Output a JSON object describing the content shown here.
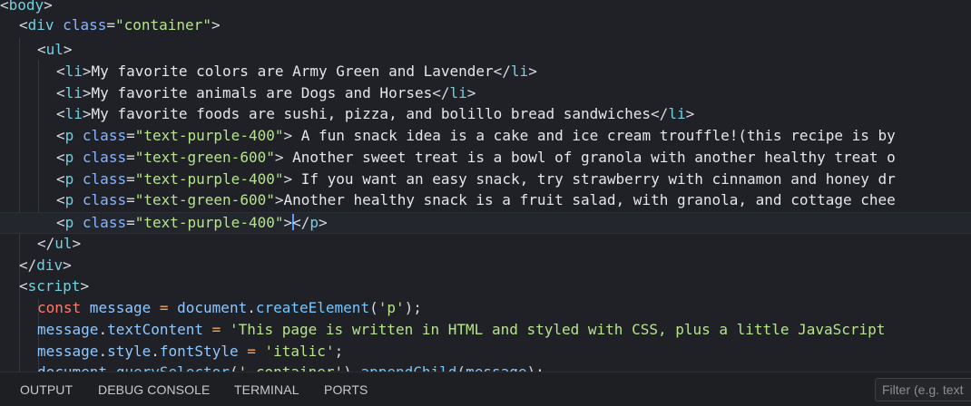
{
  "editor": {
    "lines": {
      "l0": [
        "<",
        "body",
        ">"
      ],
      "l1": [
        "<",
        "div",
        " class",
        "=",
        "\"container\"",
        ">"
      ],
      "l2": [
        "<",
        "ul",
        ">"
      ],
      "l3": [
        "<",
        "li",
        ">",
        "My favorite colors are Army Green and Lavender",
        "</",
        "li",
        ">"
      ],
      "l4": [
        "<",
        "li",
        ">",
        "My favorite animals are Dogs and Horses",
        "</",
        "li",
        ">"
      ],
      "l5": [
        "<",
        "li",
        ">",
        "My favorite foods are sushi, pizza, and bolillo bread sandwiches",
        "</",
        "li",
        ">"
      ],
      "l6": [
        "<",
        "p",
        " class",
        "=",
        "\"text-purple-400\"",
        ">",
        " A fun snack idea is a cake and ice cream trouffle!(this recipe is by"
      ],
      "l7": [
        "<",
        "p",
        " class",
        "=",
        "\"text-green-600\"",
        ">",
        " Another sweet treat is a bowl of granola with another healthy treat o"
      ],
      "l8": [
        "<",
        "p",
        " class",
        "=",
        "\"text-purple-400\"",
        ">",
        " If you want an easy snack, try strawberry with cinnamon and honey dr"
      ],
      "l9": [
        "<",
        "p",
        " class",
        "=",
        "\"text-green-600\"",
        ">",
        "Another healthy snack is a fruit salad, with granola, and cottage chee"
      ],
      "l10": [
        "<",
        "p",
        " class",
        "=",
        "\"text-purple-400\"",
        ">",
        "</",
        "p",
        ">"
      ],
      "l11": [
        "</",
        "ul",
        ">"
      ],
      "l12": [
        "</",
        "div",
        ">"
      ],
      "l13": [
        "<",
        "script",
        ">"
      ],
      "l14": [
        "const",
        " message",
        " = ",
        "document",
        ".",
        "createElement",
        "(",
        "'p'",
        ");"
      ],
      "l15": [
        "message",
        ".",
        "textContent",
        " = ",
        "'This page is written in HTML and styled with CSS, plus a little JavaScript"
      ],
      "l16": [
        "message",
        ".",
        "style",
        ".",
        "fontStyle",
        " = ",
        "'italic'",
        ";"
      ],
      "l17": [
        "document",
        ".",
        "querySelector",
        "(",
        "'.container'",
        ")",
        ".",
        "appendChild",
        "(",
        "message",
        ");"
      ]
    }
  },
  "panel": {
    "tabs": [
      "OUTPUT",
      "DEBUG CONSOLE",
      "TERMINAL",
      "PORTS"
    ],
    "filter_placeholder": "Filter (e.g. text"
  }
}
